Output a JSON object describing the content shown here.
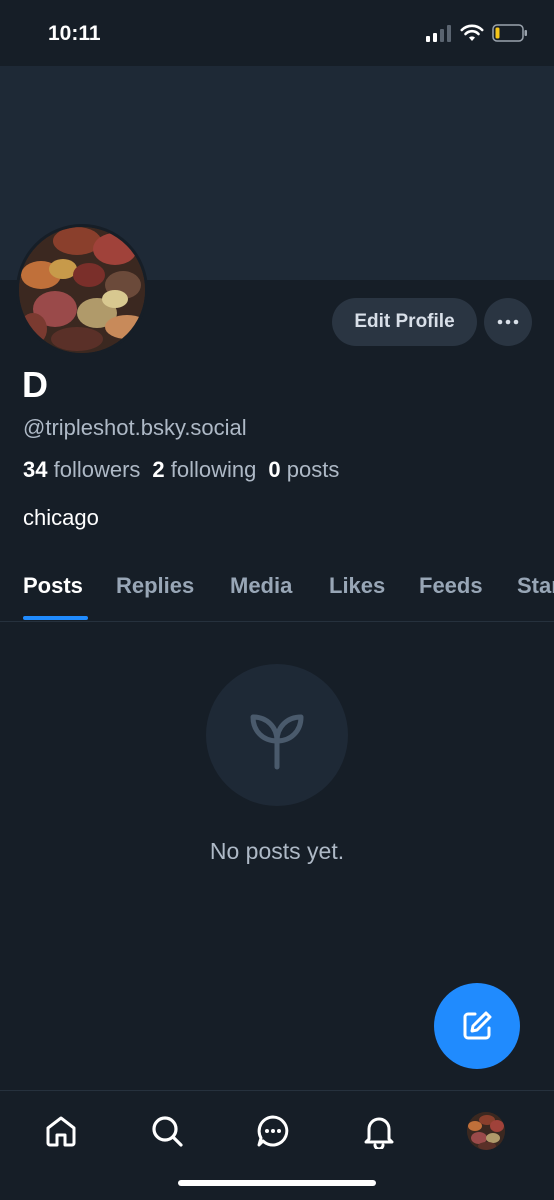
{
  "status_bar": {
    "time": "10:11"
  },
  "profile": {
    "display_name": "D",
    "handle": "@tripleshot.bsky.social",
    "followers_count": "34",
    "followers_label": "followers",
    "following_count": "2",
    "following_label": "following",
    "posts_count": "0",
    "posts_label": "posts",
    "bio": "chicago",
    "edit_label": "Edit Profile"
  },
  "tabs": [
    {
      "label": "Posts",
      "active": true
    },
    {
      "label": "Replies"
    },
    {
      "label": "Media"
    },
    {
      "label": "Likes"
    },
    {
      "label": "Feeds"
    },
    {
      "label": "Starter Packs"
    }
  ],
  "empty_state": {
    "text": "No posts yet.",
    "icon": "sprout-icon"
  },
  "bottom_nav": [
    "home-icon",
    "search-icon",
    "chat-icon",
    "bell-icon",
    "profile-avatar"
  ],
  "colors": {
    "accent": "#208bfe",
    "background": "#161e27",
    "banner": "#1e2936"
  }
}
